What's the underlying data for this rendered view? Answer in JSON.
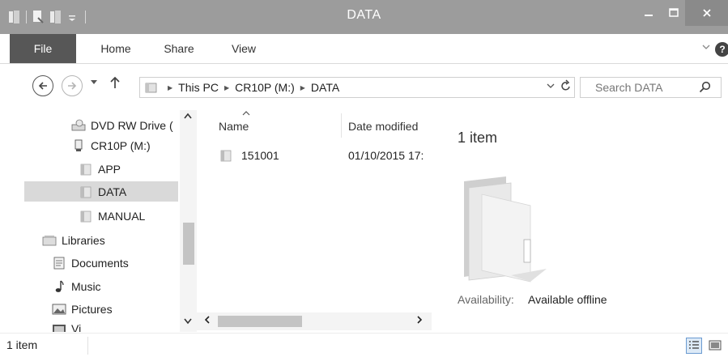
{
  "window": {
    "title": "DATA"
  },
  "ribbon": {
    "tabs": [
      "File",
      "Home",
      "Share",
      "View"
    ]
  },
  "address": {
    "crumbs": [
      "This PC",
      "CR10P (M:)",
      "DATA"
    ],
    "search_placeholder": "Search DATA"
  },
  "nav_pane": {
    "items": [
      {
        "label": "DVD RW Drive (",
        "icon": "dvd-drive-icon"
      },
      {
        "label": "CR10P (M:)",
        "icon": "usb-drive-icon"
      },
      {
        "label": "APP",
        "icon": "folder-icon"
      },
      {
        "label": "DATA",
        "icon": "folder-icon",
        "selected": true
      },
      {
        "label": "MANUAL",
        "icon": "folder-icon"
      },
      {
        "label": "Libraries",
        "icon": "libraries-icon"
      },
      {
        "label": "Documents",
        "icon": "documents-icon"
      },
      {
        "label": "Music",
        "icon": "music-icon"
      },
      {
        "label": "Pictures",
        "icon": "pictures-icon"
      },
      {
        "label": "Vi",
        "icon": "videos-icon"
      }
    ]
  },
  "file_list": {
    "columns": {
      "name": "Name",
      "date": "Date modified"
    },
    "rows": [
      {
        "name": "151001",
        "date": "01/10/2015 17:"
      }
    ]
  },
  "details": {
    "count": "1 item",
    "availability_label": "Availability:",
    "availability_value": "Available offline"
  },
  "status": {
    "text": "1 item"
  },
  "colors": {
    "titlebar": "#9c9c9c",
    "file_tab": "#575757",
    "selection": "#d9d9d9"
  }
}
